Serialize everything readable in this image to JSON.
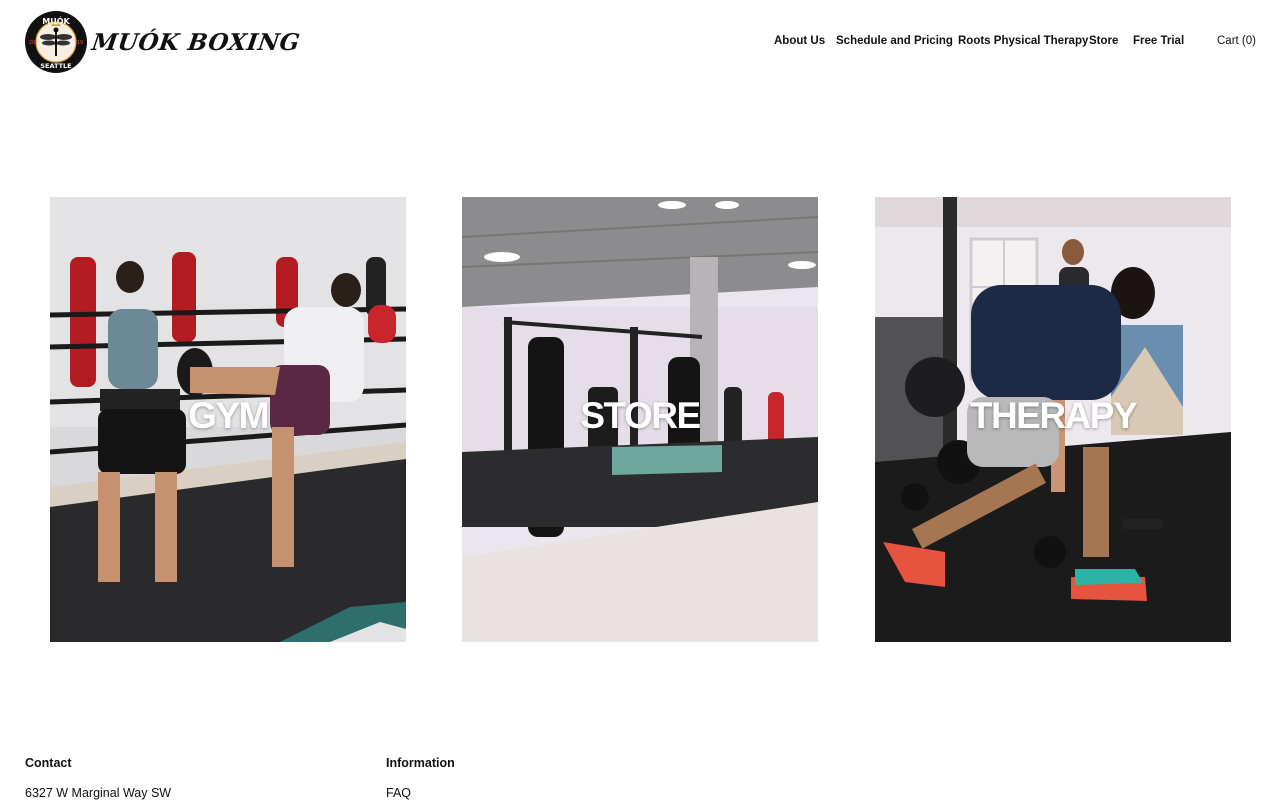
{
  "brand": {
    "name": "MUÓK BOXING",
    "badge_top": "MUÓK",
    "badge_bottom": "SEATTLE",
    "badge_year_left": "20",
    "badge_year_right": "19",
    "badge_color": "#111111",
    "badge_accent": "#d9a441"
  },
  "nav": {
    "items": [
      {
        "label": "About Us"
      },
      {
        "label": "Schedule and Pricing"
      },
      {
        "label": "Roots Physical Therapy"
      },
      {
        "label": "Store"
      },
      {
        "label": "Free Trial"
      }
    ],
    "cart_label": "Cart (0)"
  },
  "tiles": [
    {
      "label": "GYM"
    },
    {
      "label": "STORE"
    },
    {
      "label": "THERAPY"
    }
  ],
  "footer": {
    "contact": {
      "heading": "Contact",
      "address_line1": "6327 W Marginal Way SW"
    },
    "information": {
      "heading": "Information",
      "links": [
        {
          "label": "FAQ"
        }
      ]
    }
  }
}
